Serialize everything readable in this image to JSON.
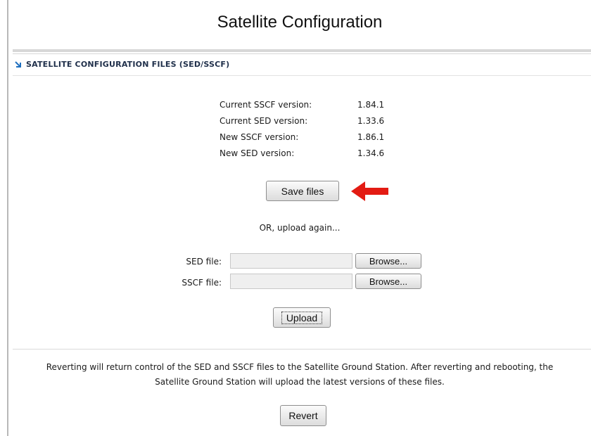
{
  "page": {
    "title": "Satellite Configuration"
  },
  "section": {
    "title": "SATELLITE CONFIGURATION FILES (SED/SSCF)",
    "accent_color": "#1f6fbf"
  },
  "versions": [
    {
      "label": "Current SSCF version:",
      "value": "1.84.1"
    },
    {
      "label": "Current SED version:",
      "value": "1.33.6"
    },
    {
      "label": "New SSCF version:",
      "value": "1.86.1"
    },
    {
      "label": "New SED version:",
      "value": "1.34.6"
    }
  ],
  "save_files": {
    "label": "Save files"
  },
  "annotation": {
    "arrow_color": "#e31b13",
    "icon": "red-arrow-icon"
  },
  "or_text": "OR, upload again...",
  "upload_form": {
    "sed": {
      "label": "SED file:",
      "value": "",
      "browse_label": "Browse..."
    },
    "sscf": {
      "label": "SSCF file:",
      "value": "",
      "browse_label": "Browse..."
    },
    "upload_label": "Upload"
  },
  "revert": {
    "text_line1": "Reverting will return control of the SED and SSCF files to the Satellite Ground Station. After reverting and rebooting, the",
    "text_line2": "Satellite Ground Station will upload the latest versions of these files.",
    "button_label": "Revert"
  }
}
